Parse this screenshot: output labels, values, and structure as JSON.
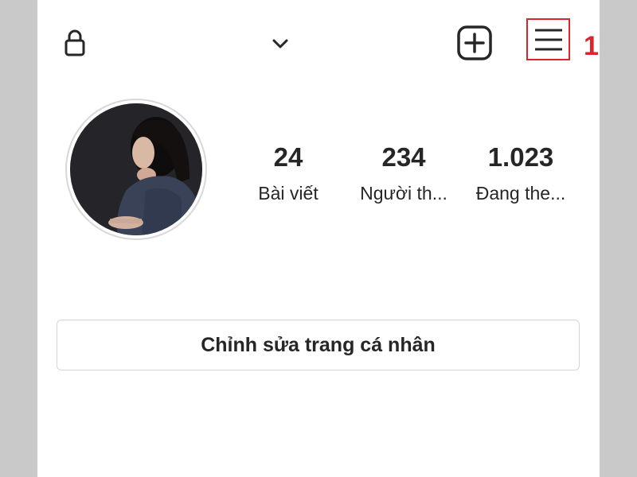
{
  "header": {
    "icons": {
      "lock": "lock-icon",
      "account_switcher": "chevron-down-icon",
      "new_post": "plus-square-icon",
      "menu": "hamburger-menu-icon"
    }
  },
  "annotation": {
    "number": "1",
    "color": "#d9252b"
  },
  "profile": {
    "stats": [
      {
        "value": "24",
        "label": "Bài viết"
      },
      {
        "value": "234",
        "label": "Người th..."
      },
      {
        "value": "1.023",
        "label": "Đang the..."
      }
    ],
    "edit_button_label": "Chỉnh sửa trang cá nhân"
  },
  "colors": {
    "text": "#262626",
    "border": "#d5d5d5",
    "highlight": "#d9252b",
    "side_bars": "#c9c9c9"
  }
}
